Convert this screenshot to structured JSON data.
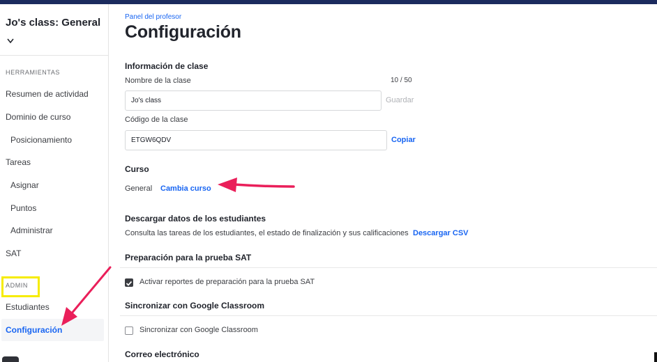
{
  "colors": {
    "accent": "#1865f2",
    "topbar": "#1b2b5e",
    "annotation_arrow": "#ea1f5a",
    "annotation_box": "#f6ec00"
  },
  "sidebar": {
    "class_title": "Jo's class: General",
    "class_chevron_icon": "chevron-down-icon",
    "sections": [
      {
        "title": "HERRAMIENTAS"
      },
      {
        "title": "ADMIN"
      }
    ],
    "items": [
      {
        "label": "Resumen de actividad"
      },
      {
        "label": "Dominio de curso"
      },
      {
        "label": "Posicionamiento"
      },
      {
        "label": "Tareas"
      },
      {
        "label": "Asignar"
      },
      {
        "label": "Puntos"
      },
      {
        "label": "Administrar"
      },
      {
        "label": "SAT"
      },
      {
        "label": "Estudiantes"
      },
      {
        "label": "Configuración",
        "active": true
      }
    ]
  },
  "main": {
    "breadcrumb": "Panel del profesor",
    "title": "Configuración",
    "class_info": {
      "title": "Información de clase",
      "name_label": "Nombre de la clase",
      "name_counter": "10 / 50",
      "name_value": "Jo's class",
      "save_label": "Guardar",
      "code_label": "Código de la clase",
      "code_value": "ETGW6QDV",
      "copy_label": "Copiar"
    },
    "course": {
      "title": "Curso",
      "current": "General",
      "change_label": "Cambia curso"
    },
    "download": {
      "title": "Descargar datos de los estudiantes",
      "description": "Consulta las tareas de los estudiantes, el estado de finalización y sus calificaciones",
      "link_label": "Descargar CSV"
    },
    "sat_prep": {
      "title": "Preparación para la prueba SAT",
      "checkbox_label": "Activar reportes de preparación para la prueba SAT",
      "checked": true
    },
    "google_sync": {
      "title": "Sincronizar con Google Classroom",
      "checkbox_label": "Sincronizar con Google Classroom",
      "checked": false
    },
    "email": {
      "title": "Correo electrónico"
    }
  }
}
